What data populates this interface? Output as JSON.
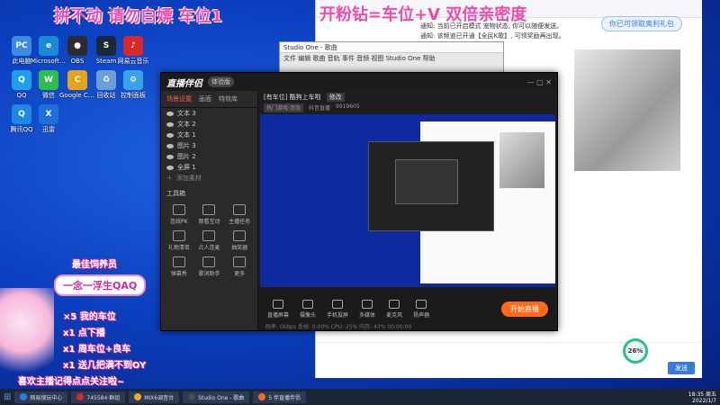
{
  "overlay": {
    "top_left": "拼不动 请勿白嫖 车位1",
    "top_right": "开粉钻=车位+V  双倍亲密度"
  },
  "desktop_icons": [
    {
      "label": "此电脑",
      "color": "#3d8be0",
      "glyph": "PC"
    },
    {
      "label": "Microsoft Edge",
      "color": "#1b8ad4",
      "glyph": "e"
    },
    {
      "label": "OBS",
      "color": "#2c2c2c",
      "glyph": "●"
    },
    {
      "label": "Steam",
      "color": "#1b2838",
      "glyph": "S"
    },
    {
      "label": "网易云音乐",
      "color": "#d8282a",
      "glyph": "♪"
    },
    {
      "label": "QQ",
      "color": "#1ea0e8",
      "glyph": "Q"
    },
    {
      "label": "微信",
      "color": "#2dbf4d",
      "glyph": "W"
    },
    {
      "label": "Google Chrome",
      "color": "#e5a41d",
      "glyph": "C"
    },
    {
      "label": "回收站",
      "color": "#6a9fd8",
      "glyph": "♻"
    },
    {
      "label": "控制面板",
      "color": "#3aa3e8",
      "glyph": "⚙"
    },
    {
      "label": "腾讯QQ",
      "color": "#1e88e5",
      "glyph": "Q"
    },
    {
      "label": "迅雷",
      "color": "#1f6fd8",
      "glyph": "X"
    }
  ],
  "qq_window": {
    "gift_label": "你已可领取奥利礼包",
    "chat_lines": [
      "通知: 当前已开启模式 宠物状态, 你可以随便发送。",
      "通知: 该频道已开通【全民K歌】, 可领奖励再出现。"
    ],
    "send_label": "发送"
  },
  "studio": {
    "title": "Studio One - 歌曲",
    "menu": "文件 编辑 歌曲 音轨 事件 音频 视图 Studio One 帮助"
  },
  "zb": {
    "logo": "直播伴侣",
    "version": "体验版",
    "tabs": [
      "场景设置",
      "画面",
      "特效库"
    ],
    "active_tab": "场景设置",
    "scenes": [
      "文本 3",
      "文本 2",
      "文本 1",
      "图片 3",
      "图片 2",
      "全屏 1"
    ],
    "add_source": "添加素材",
    "tools_header": "工具箱",
    "tools": [
      "连线PK",
      "观看互动",
      "主播任务",
      "礼物清单",
      "点人连麦",
      "抽奖器",
      "弹幕秀",
      "歌词助手",
      "更多"
    ],
    "room_title": "[有车位] 酷狗上车啦",
    "room_edit": "修改",
    "tag1": "热门游戏·泡泡",
    "tag2": "抖音直播",
    "fans": "9919605",
    "bottom_buttons": [
      "直播屏幕",
      "摄像头",
      "手机投屏",
      "多媒体",
      "麦克风",
      "扬声器"
    ],
    "start_label": "开始直播",
    "status": "码率: 0kbps  丢帧: 0.00%  CPU: 25%  内存: 43%  00:00:00"
  },
  "stickers": {
    "qaq": "一念一浮生QAQ",
    "line1": "最佳饲养员",
    "line2": "×5 我的车位",
    "line3": "x1 点下播",
    "line4": "x1 周车位+良车",
    "line5": "x1 送几把满不到OY",
    "line6": "喜欢主播记得点点关注啦~"
  },
  "taskbar": {
    "items": [
      "网易搜玩中心",
      "745584·群组",
      "MIX6调音台",
      "Studio One - 歌曲",
      "5 伴直播伴侣"
    ],
    "time": "18:35 周五",
    "date": "2022/1/7"
  },
  "perf": "26%"
}
